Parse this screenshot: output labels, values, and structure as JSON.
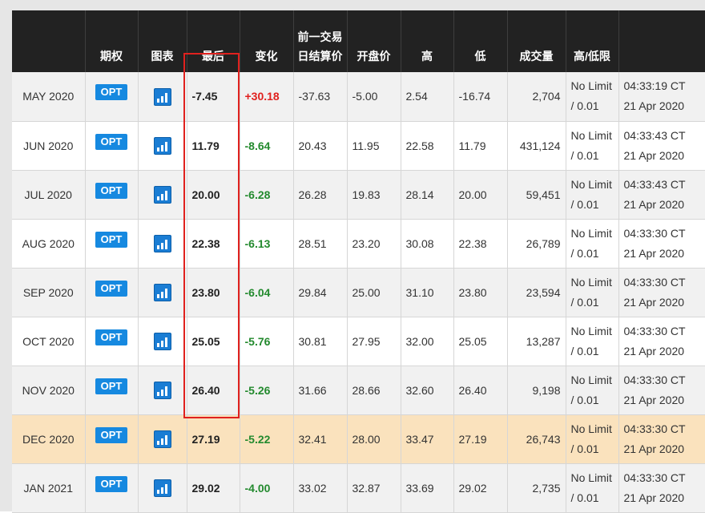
{
  "headers": {
    "month": "",
    "options": "期权",
    "chart": "图表",
    "last": "最后",
    "change": "变化",
    "prior_settle": "前一交易日结算价",
    "open": "开盘价",
    "high": "高",
    "low": "低",
    "volume": "成交量",
    "limit": "高/低限",
    "updated": ""
  },
  "opt_label": "OPT",
  "chart_icon": "bar-chart-icon",
  "colors": {
    "header_bg": "#222222",
    "opt_button": "#1689e0",
    "change_positive": "#e0211e",
    "change_negative": "#238a2e",
    "highlight_row": "#fae2bd",
    "annotation_box": "#e0211e"
  },
  "rows": [
    {
      "month": "MAY 2020",
      "last": "-7.45",
      "change": "+30.18",
      "change_dir": "pos",
      "prior_settle": "-37.63",
      "open": "-5.00",
      "high": "2.54",
      "low": "-16.74",
      "volume": "2,704",
      "limit_1": "No Limit",
      "limit_2": "/ 0.01",
      "time": "04:33:19 CT",
      "date": "21 Apr 2020"
    },
    {
      "month": "JUN 2020",
      "last": "11.79",
      "change": "-8.64",
      "change_dir": "neg",
      "prior_settle": "20.43",
      "open": "11.95",
      "high": "22.58",
      "low": "11.79",
      "volume": "431,124",
      "limit_1": "No Limit",
      "limit_2": "/ 0.01",
      "time": "04:33:43 CT",
      "date": "21 Apr 2020"
    },
    {
      "month": "JUL 2020",
      "last": "20.00",
      "change": "-6.28",
      "change_dir": "neg",
      "prior_settle": "26.28",
      "open": "19.83",
      "high": "28.14",
      "low": "20.00",
      "volume": "59,451",
      "limit_1": "No Limit",
      "limit_2": "/ 0.01",
      "time": "04:33:43 CT",
      "date": "21 Apr 2020"
    },
    {
      "month": "AUG 2020",
      "last": "22.38",
      "change": "-6.13",
      "change_dir": "neg",
      "prior_settle": "28.51",
      "open": "23.20",
      "high": "30.08",
      "low": "22.38",
      "volume": "26,789",
      "limit_1": "No Limit",
      "limit_2": "/ 0.01",
      "time": "04:33:30 CT",
      "date": "21 Apr 2020"
    },
    {
      "month": "SEP 2020",
      "last": "23.80",
      "change": "-6.04",
      "change_dir": "neg",
      "prior_settle": "29.84",
      "open": "25.00",
      "high": "31.10",
      "low": "23.80",
      "volume": "23,594",
      "limit_1": "No Limit",
      "limit_2": "/ 0.01",
      "time": "04:33:30 CT",
      "date": "21 Apr 2020"
    },
    {
      "month": "OCT 2020",
      "last": "25.05",
      "change": "-5.76",
      "change_dir": "neg",
      "prior_settle": "30.81",
      "open": "27.95",
      "high": "32.00",
      "low": "25.05",
      "volume": "13,287",
      "limit_1": "No Limit",
      "limit_2": "/ 0.01",
      "time": "04:33:30 CT",
      "date": "21 Apr 2020"
    },
    {
      "month": "NOV 2020",
      "last": "26.40",
      "change": "-5.26",
      "change_dir": "neg",
      "prior_settle": "31.66",
      "open": "28.66",
      "high": "32.60",
      "low": "26.40",
      "volume": "9,198",
      "limit_1": "No Limit",
      "limit_2": "/ 0.01",
      "time": "04:33:30 CT",
      "date": "21 Apr 2020"
    },
    {
      "month": "DEC 2020",
      "last": "27.19",
      "change": "-5.22",
      "change_dir": "neg",
      "prior_settle": "32.41",
      "open": "28.00",
      "high": "33.47",
      "low": "27.19",
      "volume": "26,743",
      "limit_1": "No Limit",
      "limit_2": "/ 0.01",
      "time": "04:33:30 CT",
      "date": "21 Apr 2020",
      "highlight": true
    },
    {
      "month": "JAN 2021",
      "last": "29.02",
      "change": "-4.00",
      "change_dir": "neg",
      "prior_settle": "33.02",
      "open": "32.87",
      "high": "33.69",
      "low": "29.02",
      "volume": "2,735",
      "limit_1": "No Limit",
      "limit_2": "/ 0.01",
      "time": "04:33:30 CT",
      "date": "21 Apr 2020"
    }
  ]
}
